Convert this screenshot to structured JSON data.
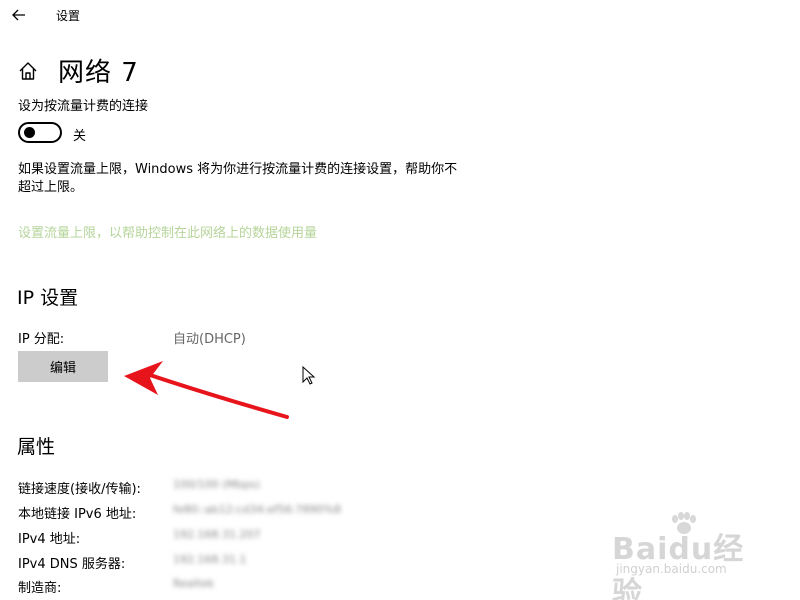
{
  "window": {
    "title": "设置"
  },
  "header": {
    "title": "网络 7"
  },
  "metered": {
    "label": "设为按流量计费的连接",
    "toggle_state": "关",
    "toggle_on": false,
    "description": "如果设置流量上限，Windows 将为你进行按流量计费的连接设置，帮助你不超过上限。",
    "link": "设置流量上限，以帮助控制在此网络上的数据使用量",
    "link_color": "#b6d49a"
  },
  "ip_settings": {
    "heading": "IP 设置",
    "assignment_label": "IP 分配:",
    "assignment_value": "自动(DHCP)",
    "edit_label": "编辑"
  },
  "properties": {
    "heading": "属性",
    "rows": [
      {
        "label": "链接速度(接收/传输):",
        "value": ""
      },
      {
        "label": "本地链接 IPv6 地址:",
        "value": ""
      },
      {
        "label": "IPv4 地址:",
        "value": ""
      },
      {
        "label": "IPv4 DNS 服务器:",
        "value": ""
      },
      {
        "label": "制造商:",
        "value": ""
      }
    ]
  },
  "annotation": {
    "arrow_color": "#e8141c"
  },
  "watermark": {
    "main": "Baidu经验",
    "sub": "jingyan.baidu.com"
  }
}
